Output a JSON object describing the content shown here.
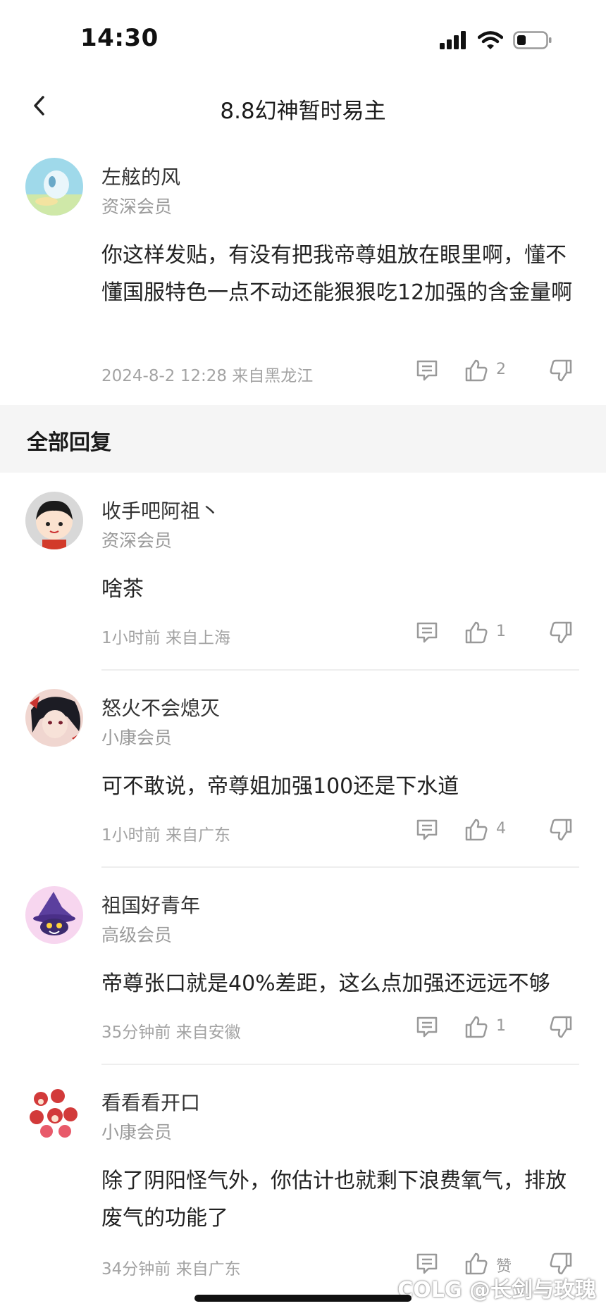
{
  "status_bar": {
    "time": "14:30"
  },
  "nav": {
    "title": "8.8幻神暂时易主"
  },
  "post": {
    "user": "左舷的风",
    "level": "资深会员",
    "content": "你这样发贴，有没有把我帝尊姐放在眼里啊，懂不懂国服特色一点不动还能狠狠吃12加强的含金量啊",
    "meta": "2024-8-2 12:28  来自黑龙江",
    "likes": "2"
  },
  "section": {
    "title": "全部回复"
  },
  "replies": [
    {
      "user": "收手吧阿祖丶",
      "level": "资深会员",
      "content": "啥茶",
      "meta": "1小时前 来自上海",
      "likes": "1"
    },
    {
      "user": "怒火不会熄灭",
      "level": "小康会员",
      "content": "可不敢说，帝尊姐加强100还是下水道",
      "meta": "1小时前 来自广东",
      "likes": "4"
    },
    {
      "user": "祖国好青年",
      "level": "高级会员",
      "content": "帝尊张口就是40%差距，这么点加强还远远不够",
      "meta": "35分钟前 来自安徽",
      "likes": "1"
    },
    {
      "user": "看看看开口",
      "level": "小康会员",
      "content": "除了阴阳怪气外，你估计也就剩下浪费氧气，排放废气的功能了",
      "meta": "34分钟前 来自广东",
      "likes": "赞"
    }
  ],
  "watermark": "COLG @长剑与玫瑰",
  "colors": {
    "accent_text": "#222222",
    "muted_text": "#a3a3a3",
    "section_bg": "#f5f5f5"
  }
}
